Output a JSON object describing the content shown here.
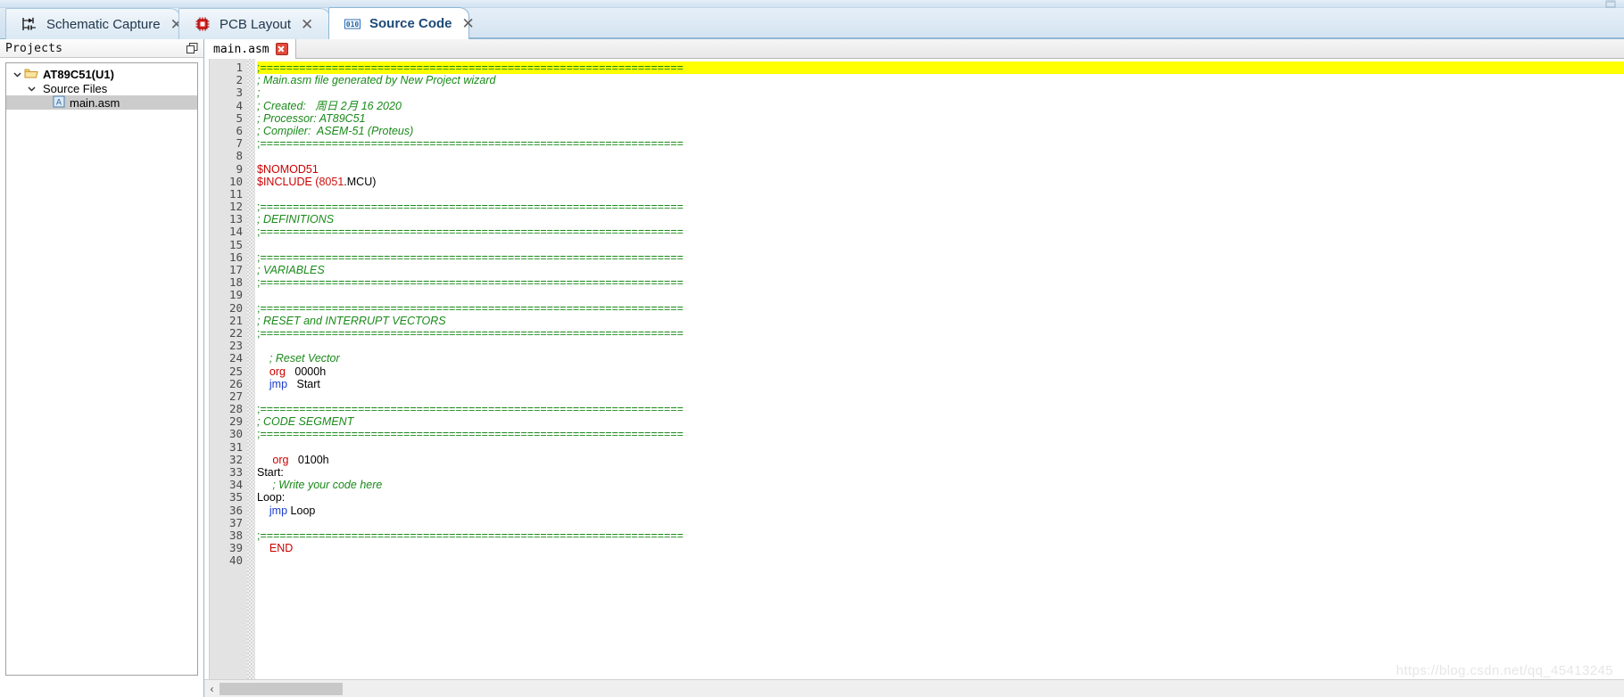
{
  "app_tabs": [
    {
      "label": "Schematic Capture",
      "icon": "schematic-capture-icon",
      "close": "✕",
      "active": false
    },
    {
      "label": "PCB Layout",
      "icon": "pcb-chip-icon",
      "close": "✕",
      "active": false
    },
    {
      "label": "Source Code",
      "icon": "binary-code-icon",
      "close": "✕",
      "active": true
    }
  ],
  "projects_panel": {
    "title": "Projects",
    "undock_icon": "undock-icon",
    "tree": [
      {
        "level": 0,
        "label": "AT89C51(U1)",
        "icon": "folder-open-icon",
        "expanded": true,
        "selected": false
      },
      {
        "level": 1,
        "label": "Source Files",
        "icon": "none",
        "expanded": true,
        "selected": false
      },
      {
        "level": 2,
        "label": "main.asm",
        "icon": "asm-file-icon",
        "expanded": null,
        "selected": true
      }
    ]
  },
  "editor": {
    "doc_tab": {
      "label": "main.asm",
      "close_icon": "close-icon"
    },
    "first_line_number": 1,
    "total_lines": 40,
    "highlight_line": 1,
    "separator_line": ";=================================================================",
    "lines": [
      {
        "n": 1,
        "tokens": [
          {
            "t": ";=================================================================",
            "c": "cmsep"
          }
        ],
        "highlight": true
      },
      {
        "n": 2,
        "tokens": [
          {
            "t": "; Main.asm file generated by New Project wizard",
            "c": "cm"
          }
        ]
      },
      {
        "n": 3,
        "tokens": [
          {
            "t": ";",
            "c": "cm"
          }
        ]
      },
      {
        "n": 4,
        "tokens": [
          {
            "t": "; Created:   周日 2月 16 2020",
            "c": "cm"
          }
        ]
      },
      {
        "n": 5,
        "tokens": [
          {
            "t": "; Processor: AT89C51",
            "c": "cm"
          }
        ]
      },
      {
        "n": 6,
        "tokens": [
          {
            "t": "; Compiler:  ASEM-51 (Proteus)",
            "c": "cm"
          }
        ]
      },
      {
        "n": 7,
        "tokens": [
          {
            "t": ";=================================================================",
            "c": "cmsep"
          }
        ]
      },
      {
        "n": 8,
        "tokens": []
      },
      {
        "n": 9,
        "tokens": [
          {
            "t": "$NOMOD51",
            "c": "kw"
          }
        ]
      },
      {
        "n": 10,
        "tokens": [
          {
            "t": "$INCLUDE (",
            "c": "kw"
          },
          {
            "t": "8051",
            "c": "num"
          },
          {
            "t": ".MCU)",
            "c": "pln"
          }
        ]
      },
      {
        "n": 11,
        "tokens": []
      },
      {
        "n": 12,
        "tokens": [
          {
            "t": ";=================================================================",
            "c": "cmsep"
          }
        ]
      },
      {
        "n": 13,
        "tokens": [
          {
            "t": "; DEFINITIONS",
            "c": "cm"
          }
        ]
      },
      {
        "n": 14,
        "tokens": [
          {
            "t": ";=================================================================",
            "c": "cmsep"
          }
        ]
      },
      {
        "n": 15,
        "tokens": []
      },
      {
        "n": 16,
        "tokens": [
          {
            "t": ";=================================================================",
            "c": "cmsep"
          }
        ]
      },
      {
        "n": 17,
        "tokens": [
          {
            "t": "; VARIABLES",
            "c": "cm"
          }
        ]
      },
      {
        "n": 18,
        "tokens": [
          {
            "t": ";=================================================================",
            "c": "cmsep"
          }
        ]
      },
      {
        "n": 19,
        "tokens": []
      },
      {
        "n": 20,
        "tokens": [
          {
            "t": ";=================================================================",
            "c": "cmsep"
          }
        ]
      },
      {
        "n": 21,
        "tokens": [
          {
            "t": "; RESET and INTERRUPT VECTORS",
            "c": "cm"
          }
        ]
      },
      {
        "n": 22,
        "tokens": [
          {
            "t": ";=================================================================",
            "c": "cmsep"
          }
        ]
      },
      {
        "n": 23,
        "tokens": []
      },
      {
        "n": 24,
        "tokens": [
          {
            "t": "    ; Reset Vector",
            "c": "cm"
          }
        ]
      },
      {
        "n": 25,
        "tokens": [
          {
            "t": "    ",
            "c": "pln"
          },
          {
            "t": "org",
            "c": "kw"
          },
          {
            "t": "   0000h",
            "c": "pln"
          }
        ]
      },
      {
        "n": 26,
        "tokens": [
          {
            "t": "    ",
            "c": "pln"
          },
          {
            "t": "jmp",
            "c": "jmp"
          },
          {
            "t": "   Start",
            "c": "pln"
          }
        ]
      },
      {
        "n": 27,
        "tokens": []
      },
      {
        "n": 28,
        "tokens": [
          {
            "t": ";=================================================================",
            "c": "cmsep"
          }
        ]
      },
      {
        "n": 29,
        "tokens": [
          {
            "t": "; CODE SEGMENT",
            "c": "cm"
          }
        ]
      },
      {
        "n": 30,
        "tokens": [
          {
            "t": ";=================================================================",
            "c": "cmsep"
          }
        ]
      },
      {
        "n": 31,
        "tokens": []
      },
      {
        "n": 32,
        "tokens": [
          {
            "t": "     ",
            "c": "pln"
          },
          {
            "t": "org",
            "c": "kw"
          },
          {
            "t": "   0100h",
            "c": "pln"
          }
        ]
      },
      {
        "n": 33,
        "tokens": [
          {
            "t": "Start:",
            "c": "pln"
          }
        ]
      },
      {
        "n": 34,
        "tokens": [
          {
            "t": "     ; Write your code here",
            "c": "cm"
          }
        ]
      },
      {
        "n": 35,
        "tokens": [
          {
            "t": "Loop:",
            "c": "pln"
          }
        ]
      },
      {
        "n": 36,
        "tokens": [
          {
            "t": "    ",
            "c": "pln"
          },
          {
            "t": "jmp",
            "c": "jmp"
          },
          {
            "t": " Loop",
            "c": "pln"
          }
        ]
      },
      {
        "n": 37,
        "tokens": []
      },
      {
        "n": 38,
        "tokens": [
          {
            "t": ";=================================================================",
            "c": "cmsep"
          }
        ]
      },
      {
        "n": 39,
        "tokens": [
          {
            "t": "    ",
            "c": "pln"
          },
          {
            "t": "END",
            "c": "kw"
          }
        ]
      },
      {
        "n": 40,
        "tokens": []
      }
    ]
  },
  "scrollbar": {
    "left_arrow": "‹",
    "thumb_label": "horizontal-scroll-thumb"
  },
  "watermark": "https://blog.csdn.net/qq_45413245",
  "colors": {
    "comment_green": "#1a8a1a",
    "keyword_red": "#cc0000",
    "jump_blue": "#1a3dd0",
    "highlight_yellow": "#ffff00",
    "gutter_gray": "#e3e3e3",
    "tab_active_blue": "#1c4a78"
  }
}
